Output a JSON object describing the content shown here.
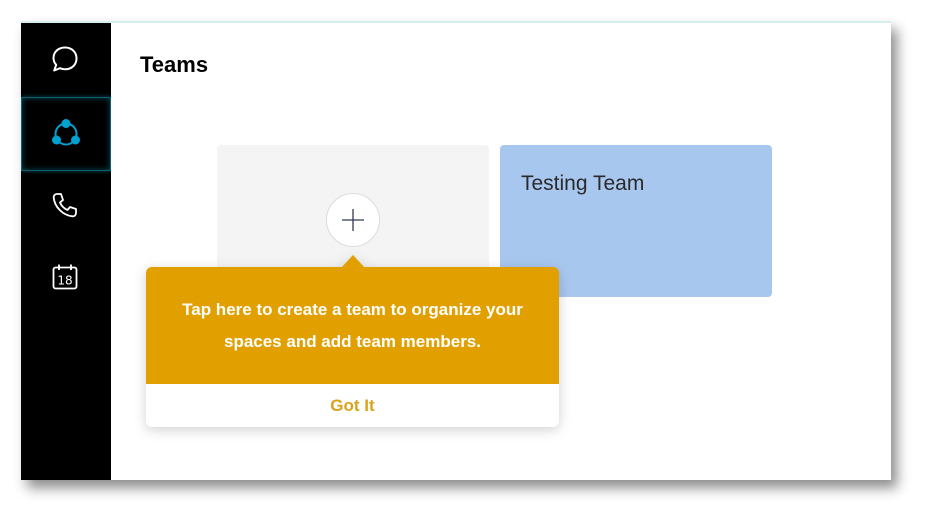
{
  "colors": {
    "rail_bg": "#000000",
    "accent_active": "#00a0d1",
    "coach_bg": "#e1a000",
    "got_it": "#dba21a",
    "team_card": "#a8c7ef"
  },
  "rail": {
    "items": [
      {
        "icon": "chat-icon"
      },
      {
        "icon": "teams-icon",
        "active": true
      },
      {
        "icon": "phone-icon"
      },
      {
        "icon": "calendar-icon",
        "label": "18"
      }
    ]
  },
  "page": {
    "title": "Teams"
  },
  "teams": [
    {
      "name": "Testing Team"
    }
  ],
  "coachmark": {
    "text": "Tap here to create a team to organize your spaces and add team members.",
    "button": "Got It"
  }
}
